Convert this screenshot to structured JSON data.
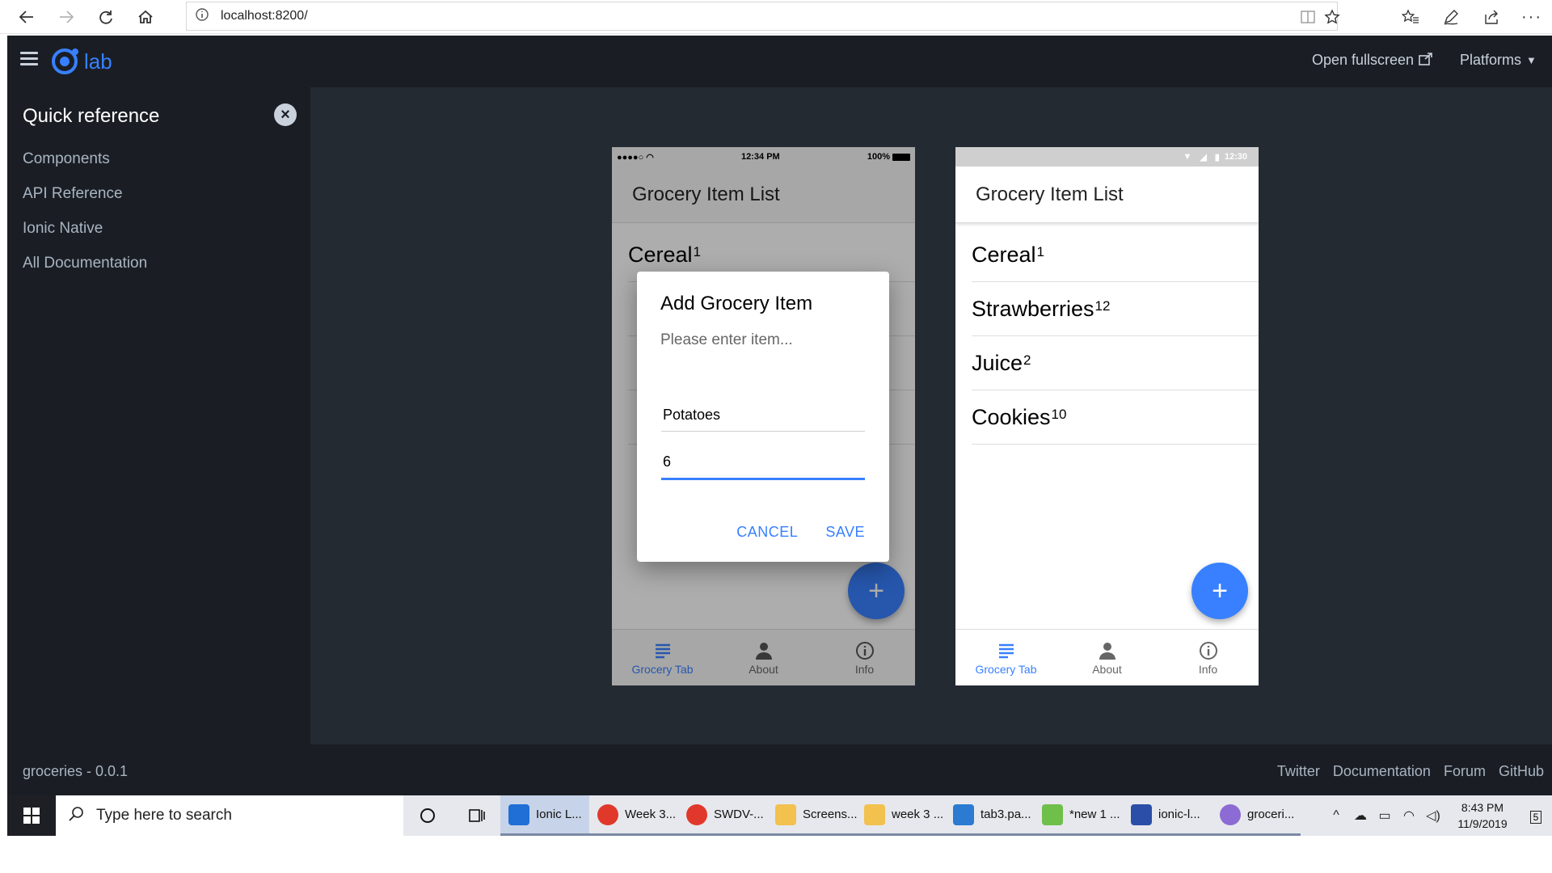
{
  "browser": {
    "url": "localhost:8200/"
  },
  "lab": {
    "logo_text": "lab",
    "open_fullscreen": "Open fullscreen",
    "platforms": "Platforms",
    "sidebar": {
      "title": "Quick reference",
      "links": [
        "Components",
        "API Reference",
        "Ionic Native",
        "All Documentation"
      ]
    },
    "footer": {
      "version": "groceries - 0.0.1",
      "links": [
        "Twitter",
        "Documentation",
        "Forum",
        "GitHub"
      ]
    }
  },
  "ios_phone": {
    "status_time": "12:34 PM",
    "status_battery": "100%",
    "title": "Grocery Item List",
    "items": [
      {
        "name": "Cereal",
        "qty": "1"
      }
    ]
  },
  "dialog": {
    "title": "Add Grocery Item",
    "message": "Please enter item...",
    "name_value": "Potatoes",
    "qty_value": "6",
    "cancel": "CANCEL",
    "save": "SAVE"
  },
  "md_phone": {
    "status_time": "12:30",
    "title": "Grocery Item List",
    "items": [
      {
        "name": "Cereal",
        "qty": "1"
      },
      {
        "name": "Strawberries",
        "qty": "12"
      },
      {
        "name": "Juice",
        "qty": "2"
      },
      {
        "name": "Cookies",
        "qty": "10"
      }
    ]
  },
  "tabs": [
    {
      "label": "Grocery Tab",
      "icon": "list-icon"
    },
    {
      "label": "About",
      "icon": "person-icon"
    },
    {
      "label": "Info",
      "icon": "info-icon"
    }
  ],
  "fab_symbol": "+",
  "taskbar": {
    "search_placeholder": "Type here to search",
    "tasks": [
      {
        "label": "Ionic L...",
        "color": "#1f6fd6"
      },
      {
        "label": "Week 3...",
        "color": "#e0392b"
      },
      {
        "label": "SWDV-...",
        "color": "#e0392b"
      },
      {
        "label": "Screens...",
        "color": "#f2c14e"
      },
      {
        "label": "week 3 ...",
        "color": "#f2c14e"
      },
      {
        "label": "tab3.pa...",
        "color": "#2a7bd1"
      },
      {
        "label": "*new 1 ...",
        "color": "#6fbf4b"
      },
      {
        "label": "ionic-l...",
        "color": "#2b4fa8"
      },
      {
        "label": "groceri...",
        "color": "#8c6bd4"
      }
    ],
    "clock_time": "8:43 PM",
    "clock_date": "11/9/2019",
    "notification_count": "5"
  },
  "colors": {
    "primary": "#3880ff",
    "lab_bg": "#1a1e24",
    "stage_bg": "#242a31"
  }
}
